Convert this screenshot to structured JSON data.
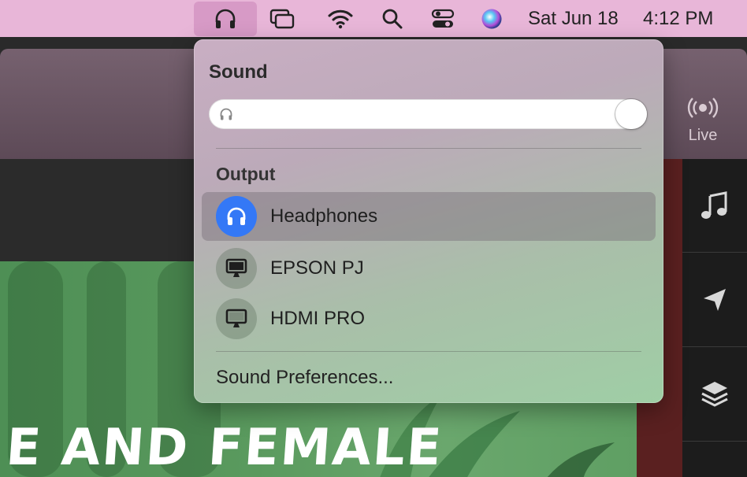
{
  "menubar": {
    "date": "Sat Jun 18",
    "time": "4:12 PM",
    "icons": [
      "headphones-icon",
      "screen-mirroring-icon",
      "wifi-icon",
      "search-icon",
      "control-center-icon",
      "siri-icon"
    ]
  },
  "background_app": {
    "live_label": "Live",
    "banner_text": "E AND FEMALE",
    "rail_icons": [
      "music-note-icon",
      "send-icon",
      "layers-icon"
    ]
  },
  "sound_popover": {
    "title": "Sound",
    "volume_fraction": 1.0,
    "output_label": "Output",
    "devices": [
      {
        "label": "Headphones",
        "icon": "headphones-icon",
        "selected": true
      },
      {
        "label": "EPSON PJ",
        "icon": "display-icon",
        "selected": false
      },
      {
        "label": "HDMI PRO",
        "icon": "display-icon",
        "selected": false
      }
    ],
    "preferences_label": "Sound Preferences..."
  },
  "colors": {
    "menubar": "#e8b6d8",
    "accent_blue": "#3478f6"
  }
}
